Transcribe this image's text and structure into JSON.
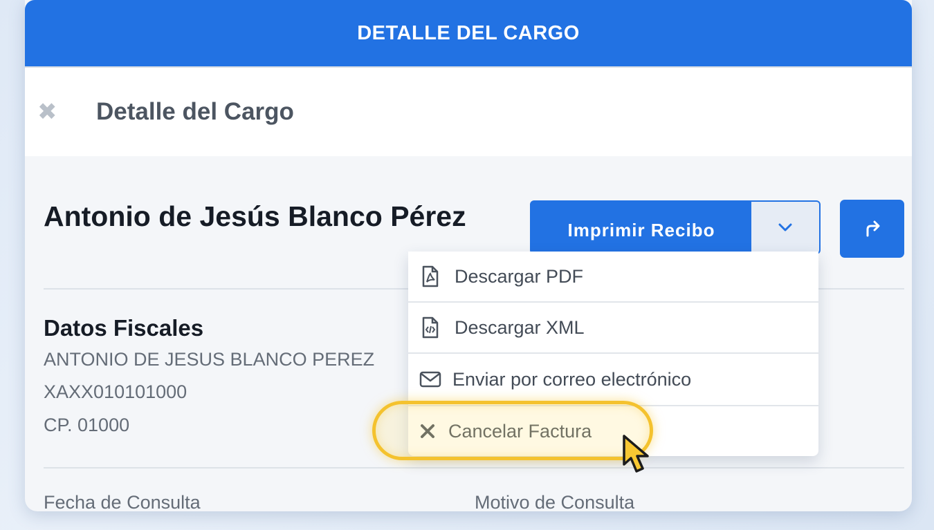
{
  "banner": {
    "title": "DETALLE DEL CARGO"
  },
  "subheader": {
    "title": "Detalle del Cargo",
    "close_icon": "close-icon"
  },
  "patient": {
    "name": "Antonio de Jesús Blanco Pérez"
  },
  "actions": {
    "print_label": "Imprimir Recibo",
    "dropdown_icon": "chevron-down-icon",
    "share_icon": "share-icon",
    "accent_color": "#2272e3"
  },
  "dropdown": {
    "items": [
      {
        "label": "Descargar PDF",
        "icon": "pdf-file-icon"
      },
      {
        "label": "Descargar XML",
        "icon": "xml-file-icon"
      },
      {
        "label": "Enviar por correo electrónico",
        "icon": "envelope-icon"
      },
      {
        "label": "Cancelar Factura",
        "icon": "close-icon",
        "highlighted": true
      }
    ],
    "highlight_color": "#f4c22e"
  },
  "fiscal": {
    "title": "Datos Fiscales",
    "name": "ANTONIO DE JESUS BLANCO PEREZ",
    "rfc": "XAXX010101000",
    "postal_code": "CP. 01000"
  },
  "details": {
    "consult_date_label": "Fecha de Consulta",
    "consult_reason_label": "Motivo de Consulta"
  }
}
